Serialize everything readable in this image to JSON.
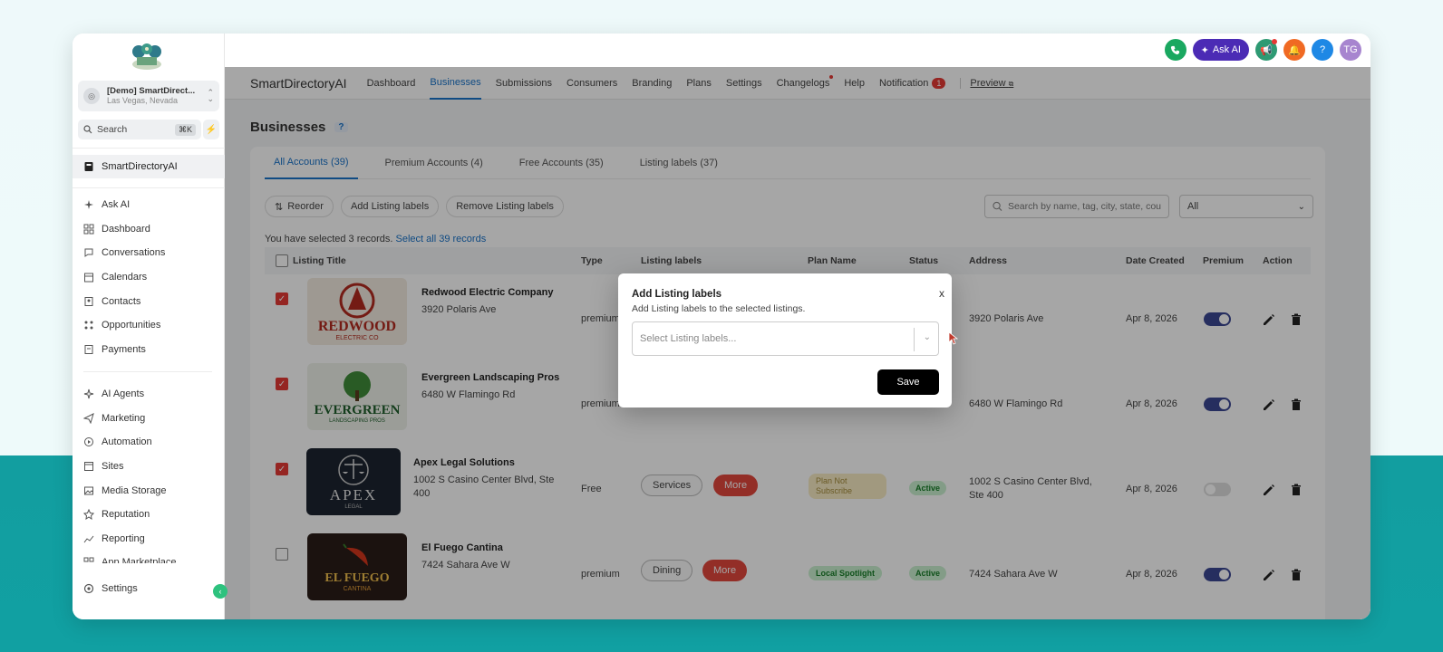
{
  "sidebar": {
    "location_name": "[Demo] SmartDirect...",
    "location_city": "Las Vegas, Nevada",
    "search_label": "Search",
    "search_shortcut": "⌘K",
    "active_item": "SmartDirectoryAI",
    "items_group1": [
      {
        "label": "Ask AI",
        "icon": "sparkle-icon"
      },
      {
        "label": "Dashboard",
        "icon": "grid-icon"
      },
      {
        "label": "Conversations",
        "icon": "chat-bubble-icon"
      },
      {
        "label": "Calendars",
        "icon": "calendar-icon"
      },
      {
        "label": "Contacts",
        "icon": "contacts-icon"
      },
      {
        "label": "Opportunities",
        "icon": "opportunities-icon"
      },
      {
        "label": "Payments",
        "icon": "payments-icon"
      }
    ],
    "items_group2": [
      {
        "label": "AI Agents",
        "icon": "ai-agents-icon"
      },
      {
        "label": "Marketing",
        "icon": "send-icon"
      },
      {
        "label": "Automation",
        "icon": "automation-icon"
      },
      {
        "label": "Sites",
        "icon": "sites-icon"
      },
      {
        "label": "Media Storage",
        "icon": "image-icon"
      },
      {
        "label": "Reputation",
        "icon": "star-icon"
      },
      {
        "label": "Reporting",
        "icon": "chart-line-icon"
      },
      {
        "label": "App Marketplace",
        "icon": "apps-icon"
      }
    ],
    "settings_label": "Settings"
  },
  "topbar": {
    "ask_ai_label": "Ask AI",
    "avatar_initials": "TG",
    "help_label": "?"
  },
  "subnav": {
    "brand": "SmartDirectoryAI",
    "tabs": [
      "Dashboard",
      "Businesses",
      "Submissions",
      "Consumers",
      "Branding",
      "Plans",
      "Settings",
      "Changelogs",
      "Help",
      "Notification"
    ],
    "active_tab": "Businesses",
    "notification_count": "1",
    "preview_label": "Preview"
  },
  "page": {
    "title": "Businesses",
    "help_q": "?"
  },
  "account_tabs": [
    "All Accounts (39)",
    "Premium Accounts (4)",
    "Free Accounts (35)",
    "Listing labels (37)"
  ],
  "actions": {
    "reorder": "Reorder",
    "add_labels": "Add Listing labels",
    "remove_labels": "Remove Listing labels",
    "search_placeholder": "Search by name, tag, city, state, cou",
    "filter_value": "All"
  },
  "selection": {
    "note": "You have selected 3 records.",
    "select_all": "Select all 39 records"
  },
  "table": {
    "headers": {
      "title": "Listing Title",
      "type": "Type",
      "labels": "Listing labels",
      "plan": "Plan Name",
      "status": "Status",
      "address": "Address",
      "date": "Date Created",
      "premium": "Premium",
      "action": "Action"
    },
    "rows": [
      {
        "name": "Redwood Electric Company",
        "addr": "3920 Polaris Ave",
        "type": "premium",
        "address": "3920 Polaris Ave",
        "date": "Apr 8, 2026",
        "checked": true,
        "premium": true,
        "thumb_text": "REDWOOD",
        "thumb_sub": "ELECTRIC CO"
      },
      {
        "name": "Evergreen Landscaping Pros",
        "addr": "6480 W Flamingo Rd",
        "type": "premium",
        "address": "6480 W Flamingo Rd",
        "date": "Apr 8, 2026",
        "checked": true,
        "premium": true,
        "thumb_text": "EVERGREEN",
        "thumb_sub": "LANDSCAPING PROS"
      },
      {
        "name": "Apex Legal Solutions",
        "addr1": "1002 S Casino Center Blvd, Ste",
        "addr2": "400",
        "type": "Free",
        "label": "Services",
        "more": "More",
        "plan": "Plan Not Subscribe",
        "status": "Active",
        "address1": "1002 S Casino Center Blvd,",
        "address2": "Ste 400",
        "date": "Apr 8, 2026",
        "checked": true,
        "premium": false,
        "thumb_text": "APEX",
        "thumb_sub": "LEGAL"
      },
      {
        "name": "El Fuego Cantina",
        "addr": "7424 Sahara Ave W",
        "type": "premium",
        "label": "Dining",
        "more": "More",
        "plan": "Local Spotlight",
        "status": "Active",
        "address": "7424 Sahara Ave W",
        "date": "Apr 8, 2026",
        "checked": false,
        "premium": true,
        "thumb_text": "EL FUEGO",
        "thumb_sub": "CANTINA"
      }
    ]
  },
  "modal": {
    "title": "Add Listing labels",
    "subtitle": "Add Listing labels to the selected listings.",
    "close": "x",
    "select_placeholder": "Select Listing labels...",
    "save": "Save"
  },
  "colors": {
    "accent_blue": "#1a73c9",
    "ask_ai_purple": "#4b2bb5",
    "more_red": "#e2473d",
    "toggle_on": "#3b4792"
  }
}
